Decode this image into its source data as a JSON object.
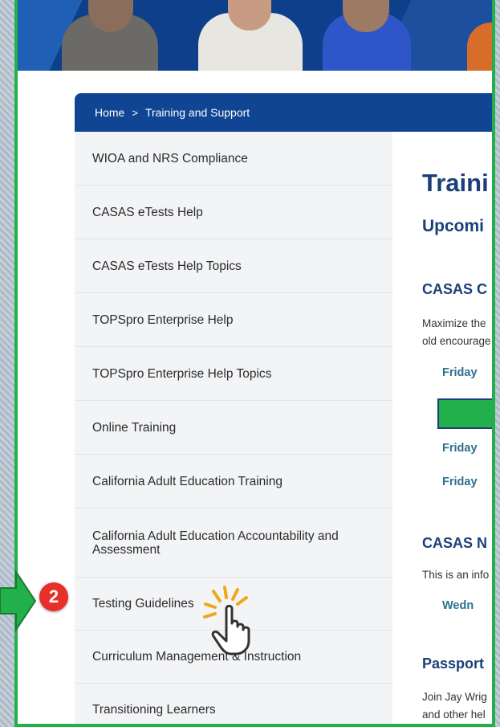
{
  "breadcrumb": {
    "home": "Home",
    "separator": ">",
    "current": "Training and Support"
  },
  "sidebar": {
    "items": [
      {
        "label": "WIOA and NRS Compliance"
      },
      {
        "label": "CASAS eTests Help"
      },
      {
        "label": "CASAS eTests Help Topics"
      },
      {
        "label": "TOPSpro Enterprise Help"
      },
      {
        "label": "TOPSpro Enterprise Help Topics"
      },
      {
        "label": "Online Training"
      },
      {
        "label": "California Adult Education Training"
      },
      {
        "label": "California Adult Education Accountability and Assessment"
      },
      {
        "label": "Testing Guidelines"
      },
      {
        "label": "Curriculum Management & Instruction"
      },
      {
        "label": "Transitioning Learners"
      }
    ]
  },
  "main": {
    "title": "Traini",
    "subtitle": "Upcomi",
    "section1": {
      "heading": "CASAS C",
      "text_line1": "Maximize the",
      "text_line2": "old encourage",
      "dates": [
        "Friday",
        "Friday",
        "Friday"
      ]
    },
    "section2": {
      "heading": "CASAS N",
      "text": "This is an info",
      "date": "Wedn"
    },
    "section3": {
      "heading": "Passport",
      "text_line1": "Join Jay Wrig",
      "text_line2": "and other hel"
    }
  },
  "overlay": {
    "step_number": "2",
    "arrow_color": "#22b04b",
    "badge_color": "#e8302b"
  },
  "colors": {
    "nav_blue": "#0f4592",
    "heading_blue": "#1b3f78",
    "frame_green": "#22b04b"
  }
}
